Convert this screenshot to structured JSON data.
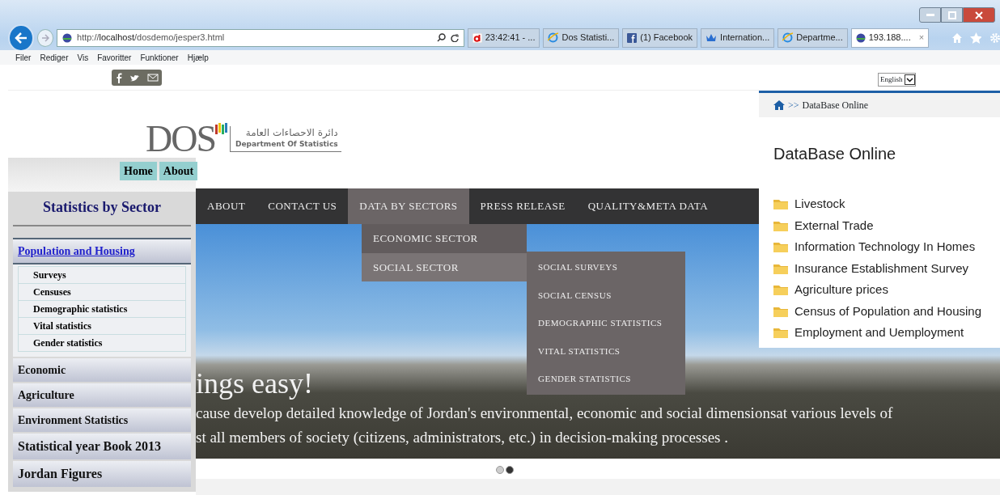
{
  "browser": {
    "address": "http://**localhost**/dosdemo/jesper3.html",
    "tabs": [
      {
        "title": "23:42:41 - ...",
        "kind": "letter",
        "selected": false
      },
      {
        "title": "Dos Statisti...",
        "kind": "globe",
        "selected": false
      },
      {
        "title": "(1) Facebook",
        "kind": "square",
        "selected": false
      },
      {
        "title": "Internation...",
        "kind": "crown",
        "selected": false
      },
      {
        "title": "Departme...",
        "kind": "globe",
        "selected": false
      },
      {
        "title": "193.188....",
        "kind": "site",
        "selected": true
      }
    ],
    "close_tab": "×",
    "menu": [
      "Filer",
      "Rediger",
      "Vis",
      "Favoritter",
      "Funktioner",
      "Hjælp"
    ]
  },
  "language": "English",
  "logo": {
    "mark": "DOS",
    "arabic": "دائرة الاحصاءات العامة",
    "subtitle": "Department Of Statistics"
  },
  "top_links": [
    "Home",
    "About"
  ],
  "nav": [
    {
      "label": "ABOUT",
      "selected": false
    },
    {
      "label": "CONTACT US",
      "selected": false
    },
    {
      "label": "DATA BY SECTORS",
      "selected": true
    },
    {
      "label": "PRESS RELEASE",
      "selected": false
    },
    {
      "label": "QUALITY&META DATA",
      "selected": false
    }
  ],
  "dropdown": [
    {
      "label": "ECONOMIC SECTOR",
      "selected": false
    },
    {
      "label": "SOCIAL SECTOR",
      "selected": true
    }
  ],
  "submenu": [
    "SOCIAL SURVEYS",
    "SOCIAL CENSUS",
    "DEMOGRAPHIC STATISTICS",
    "VITAL STATISTICS",
    "GENDER STATISTICS"
  ],
  "hero": {
    "headline": "ings easy!",
    "lines": [
      "cause develop detailed knowledge of Jordan's environmental, economic and social dimensionsat various levels of",
      "st all members of society (citizens, administrators, etc.) in decision-making processes ."
    ]
  },
  "carousel_dots": [
    {
      "selected": false
    },
    {
      "selected": true
    }
  ],
  "sidebar": {
    "title": "Statistics by Sector",
    "items": [
      {
        "label": "Population and Housing",
        "expanded": true,
        "children": [
          {
            "label": "Surveys"
          },
          {
            "label": "Censuses"
          },
          {
            "label": "Demographic statistics"
          },
          {
            "label": "Vital statistics"
          },
          {
            "label": "Gender statistics"
          }
        ]
      },
      {
        "label": "Economic",
        "expanded": false
      },
      {
        "label": "Agriculture",
        "expanded": false
      },
      {
        "label": "Environment Statistics",
        "expanded": false
      },
      {
        "label": "Statistical year Book 2013",
        "expanded": false
      },
      {
        "label": "Jordan Figures",
        "expanded": false
      }
    ]
  },
  "database": {
    "breadcrumb_separator": ">>",
    "breadcrumb": "DataBase Online",
    "heading": "DataBase Online",
    "folders": [
      "Livestock",
      "External Trade",
      "Information Technology In Homes",
      "Insurance Establishment Survey",
      "Agriculture prices",
      "Census of Population and Housing",
      "Employment and Uemployment"
    ]
  }
}
